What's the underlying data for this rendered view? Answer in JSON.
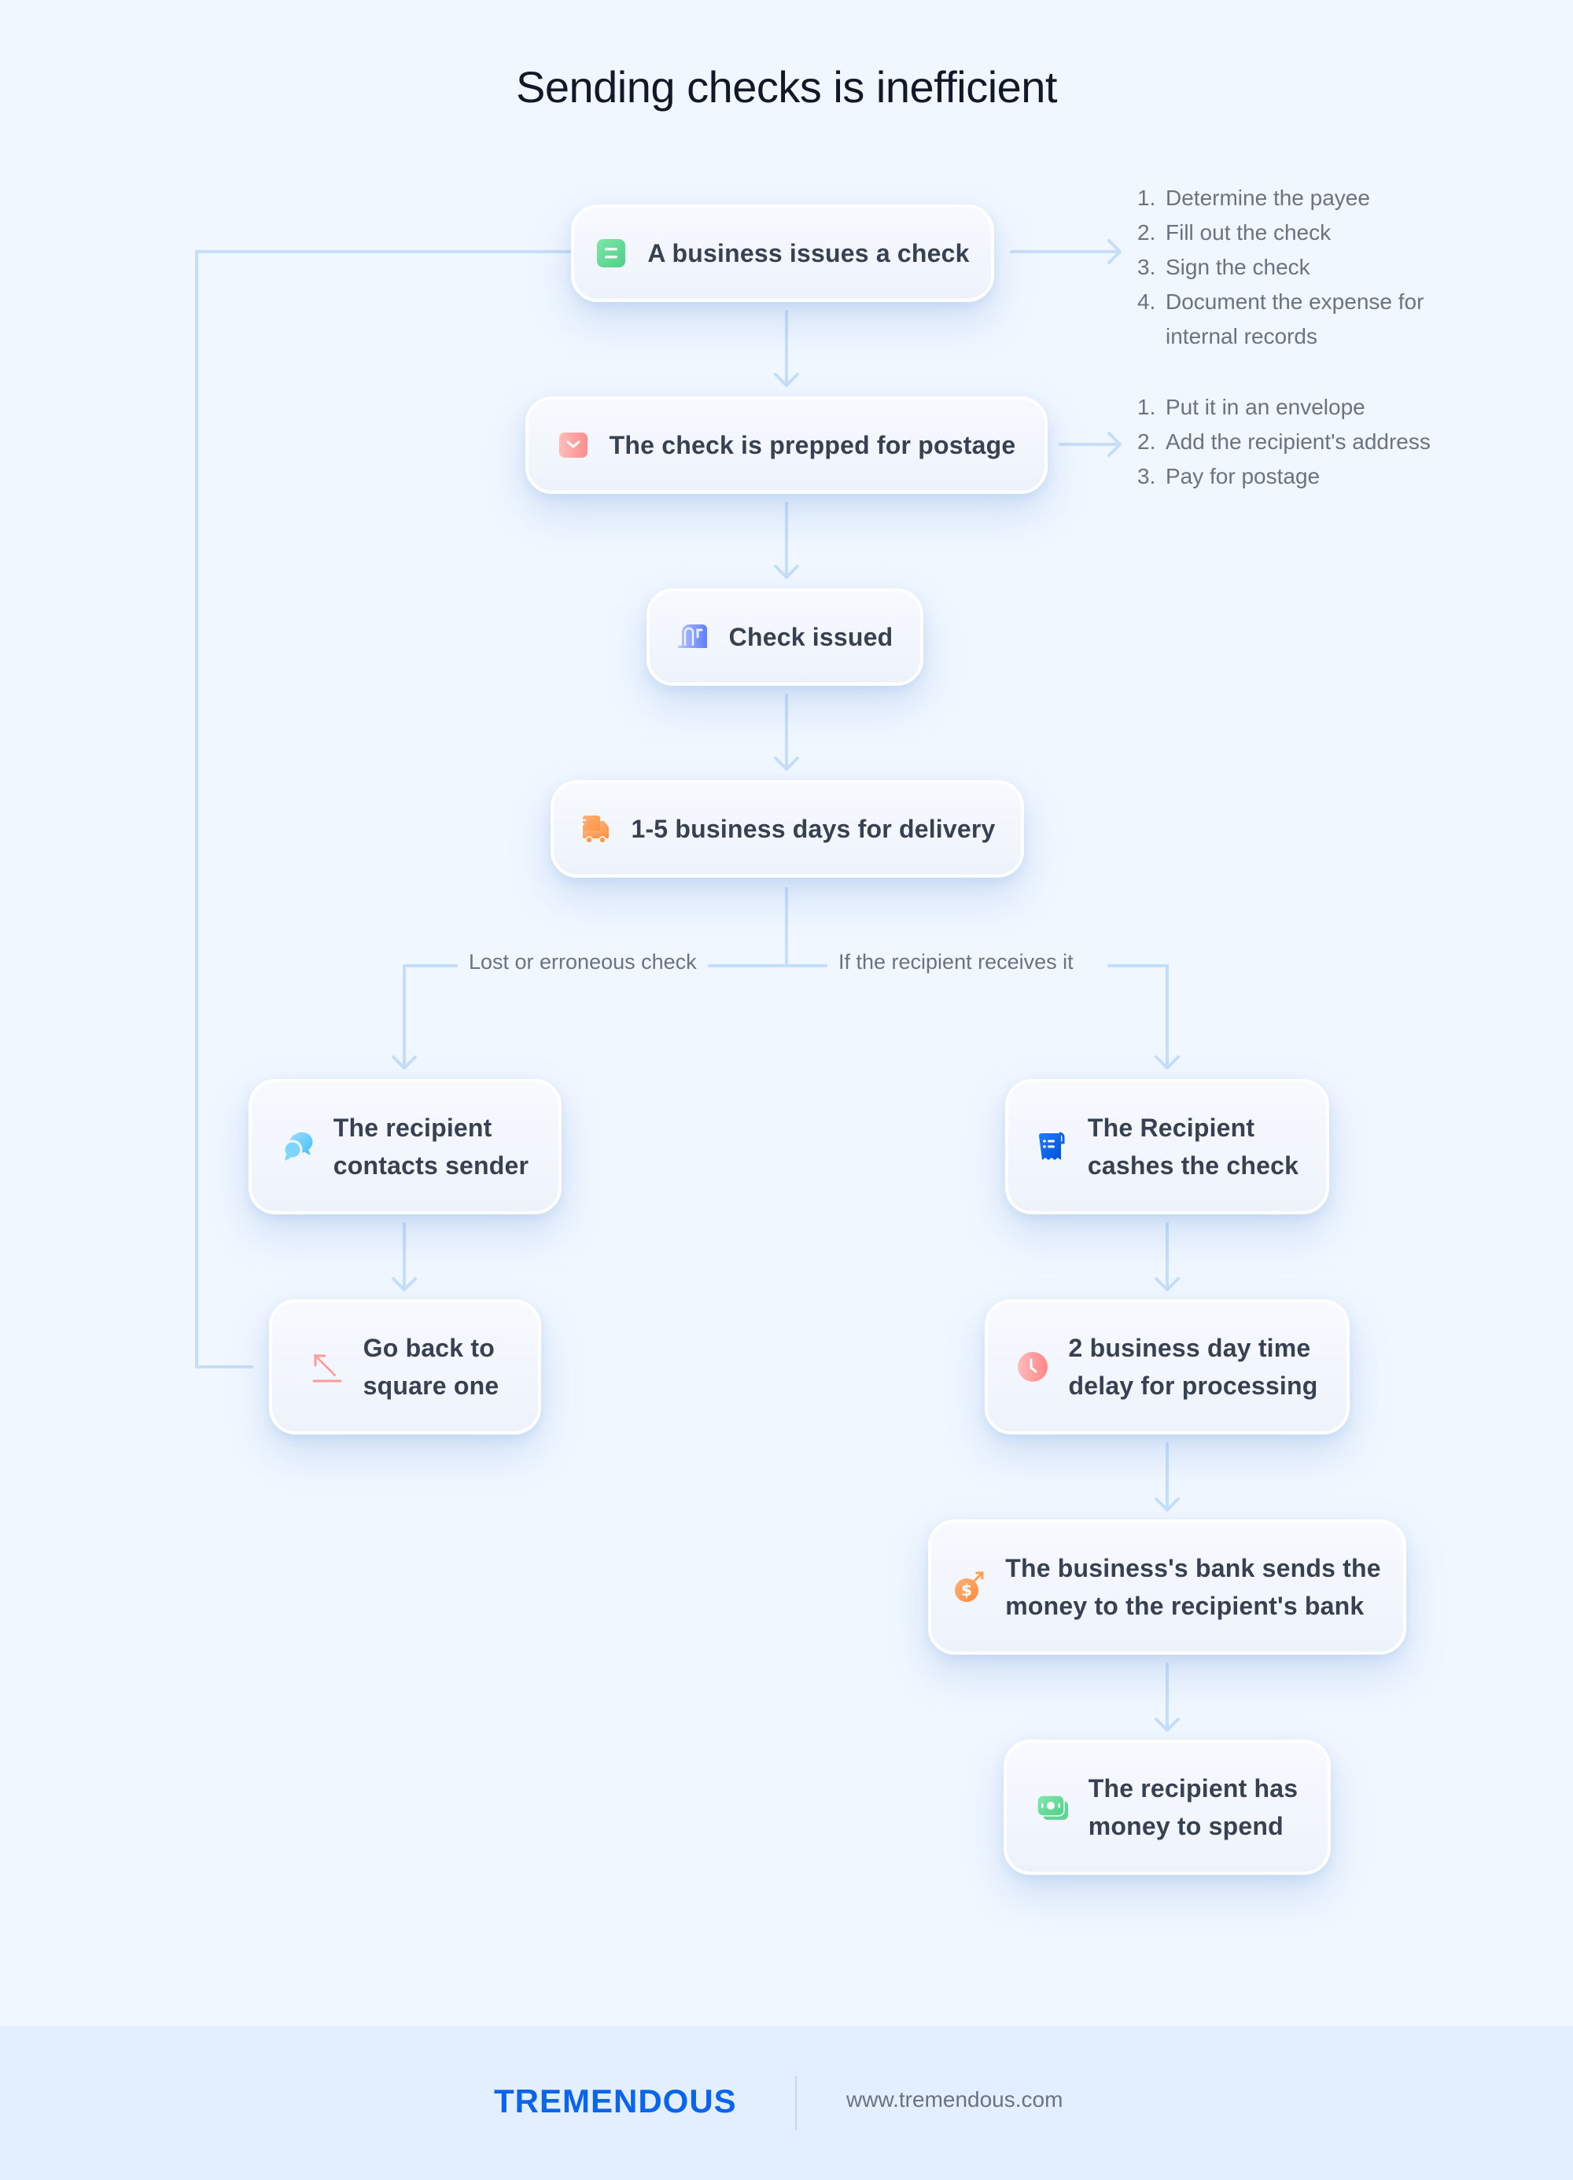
{
  "title": "Sending checks is inefficient",
  "colors": {
    "background": "#f0f7ff",
    "connector": "#c5defa",
    "node_text": "#374151",
    "muted_text": "#6b7280",
    "brand": "#0a64ec",
    "footer_bg": "#e3effe"
  },
  "nodes": [
    {
      "id": "issue",
      "label": "A business issues a check",
      "icon": "check-document-icon",
      "icon_color": "#5fd693"
    },
    {
      "id": "prep",
      "label": "The check is prepped for postage",
      "icon": "envelope-icon",
      "icon_color": "#ff8f8f"
    },
    {
      "id": "issued",
      "label": "Check issued",
      "icon": "mailbox-icon",
      "icon_color": "#6f8cff"
    },
    {
      "id": "delivery",
      "label": "1-5 business days for delivery",
      "icon": "delivery-truck-icon",
      "icon_color": "#ff9c50"
    },
    {
      "id": "contacts",
      "label": "The recipient\ncontacts sender",
      "icon": "chat-bubbles-icon",
      "icon_color": "#55c8f7"
    },
    {
      "id": "back",
      "label": "Go back to\nsquare one",
      "icon": "arrow-up-left-icon",
      "icon_color": "#ff9a9a"
    },
    {
      "id": "cashes",
      "label": "The Recipient\ncashes the check",
      "icon": "receipt-icon",
      "icon_color": "#0b63e6"
    },
    {
      "id": "delay",
      "label": "2 business day time\ndelay for processing",
      "icon": "clock-icon",
      "icon_color": "#ff8f8f"
    },
    {
      "id": "bank",
      "label": "The business's bank sends the\nmoney to the recipient's bank",
      "icon": "money-transfer-icon",
      "icon_color": "#ff9c50"
    },
    {
      "id": "spend",
      "label": "The recipient has\nmoney to spend",
      "icon": "cash-stack-icon",
      "icon_color": "#5fd693"
    }
  ],
  "side_lists": {
    "issue_steps": [
      {
        "num": "1.",
        "text": "Determine the payee"
      },
      {
        "num": "2.",
        "text": "Fill out the check"
      },
      {
        "num": "3.",
        "text": "Sign the check"
      },
      {
        "num": "4.",
        "text": "Document the expense for\ninternal records"
      }
    ],
    "prep_steps": [
      {
        "num": "1.",
        "text": "Put it in an envelope"
      },
      {
        "num": "2.",
        "text": "Add the recipient's address"
      },
      {
        "num": "3.",
        "text": "Pay for postage"
      }
    ]
  },
  "branches": {
    "left": "Lost or erroneous check",
    "right": "If the recipient receives it"
  },
  "footer": {
    "brand": "TREMENDOUS",
    "website": "www.tremendous.com"
  }
}
